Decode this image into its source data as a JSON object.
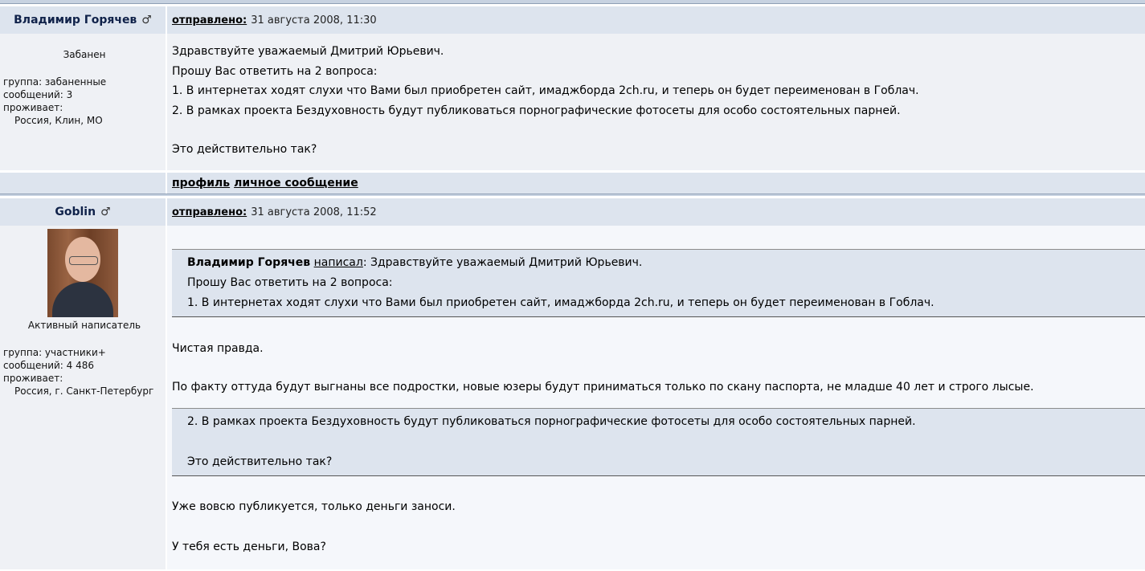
{
  "labels": {
    "posted": "отправлено:",
    "profile": "профиль",
    "pm": "личное сообщение",
    "wrote": "написал",
    "male_icon": "♂"
  },
  "post1": {
    "author": "Владимир Горячев",
    "date": "31 августа 2008, 11:30",
    "rank": "Забанен",
    "group": "группа: забаненные",
    "messages": "сообщений: 3",
    "lives": "проживает:",
    "location": "Россия, Клин, МО",
    "lines": [
      "Здравствуйте уважаемый Дмитрий Юрьевич.",
      "Прошу Вас ответить на 2 вопроса:",
      "1. В интернетах ходят слухи что Вами был приобретен сайт, имаджборда 2ch.ru, и теперь он будет переименован в Гоблач.",
      "2. В рамках проекта Бездуховность будут публиковаться порнографические фотосеты для особо состоятельных парней.",
      "Это действительно так?"
    ]
  },
  "post2": {
    "author": "Goblin",
    "date": "31 августа 2008, 11:52",
    "rank": "Активный написатель",
    "group": "группа: участники+",
    "messages": "сообщений: 4 486",
    "lives": "проживает:",
    "location": "Россия, г. Санкт-Петербург",
    "quote1": {
      "author": "Владимир Горячев",
      "lines": [
        ": Здравствуйте уважаемый Дмитрий Юрьевич.",
        "Прошу Вас ответить на 2 вопроса:",
        "1. В интернетах ходят слухи что Вами был приобретен сайт, имаджборда 2ch.ru, и теперь он будет переименован в Гоблач."
      ]
    },
    "reply1": "Чистая правда.",
    "reply2": "По факту оттуда будут выгнаны все подростки, новые юзеры будут приниматься только по скану паспорта, не младше 40 лет и строго лысые.",
    "quote2": {
      "lines": [
        "2. В рамках проекта Бездуховность будут публиковаться порнографические фотосеты для особо состоятельных парней.",
        "Это действительно так?"
      ]
    },
    "reply3": "Уже вовсю публикуется, только деньги заноси.",
    "reply4": "У тебя есть деньги, Вова?"
  }
}
